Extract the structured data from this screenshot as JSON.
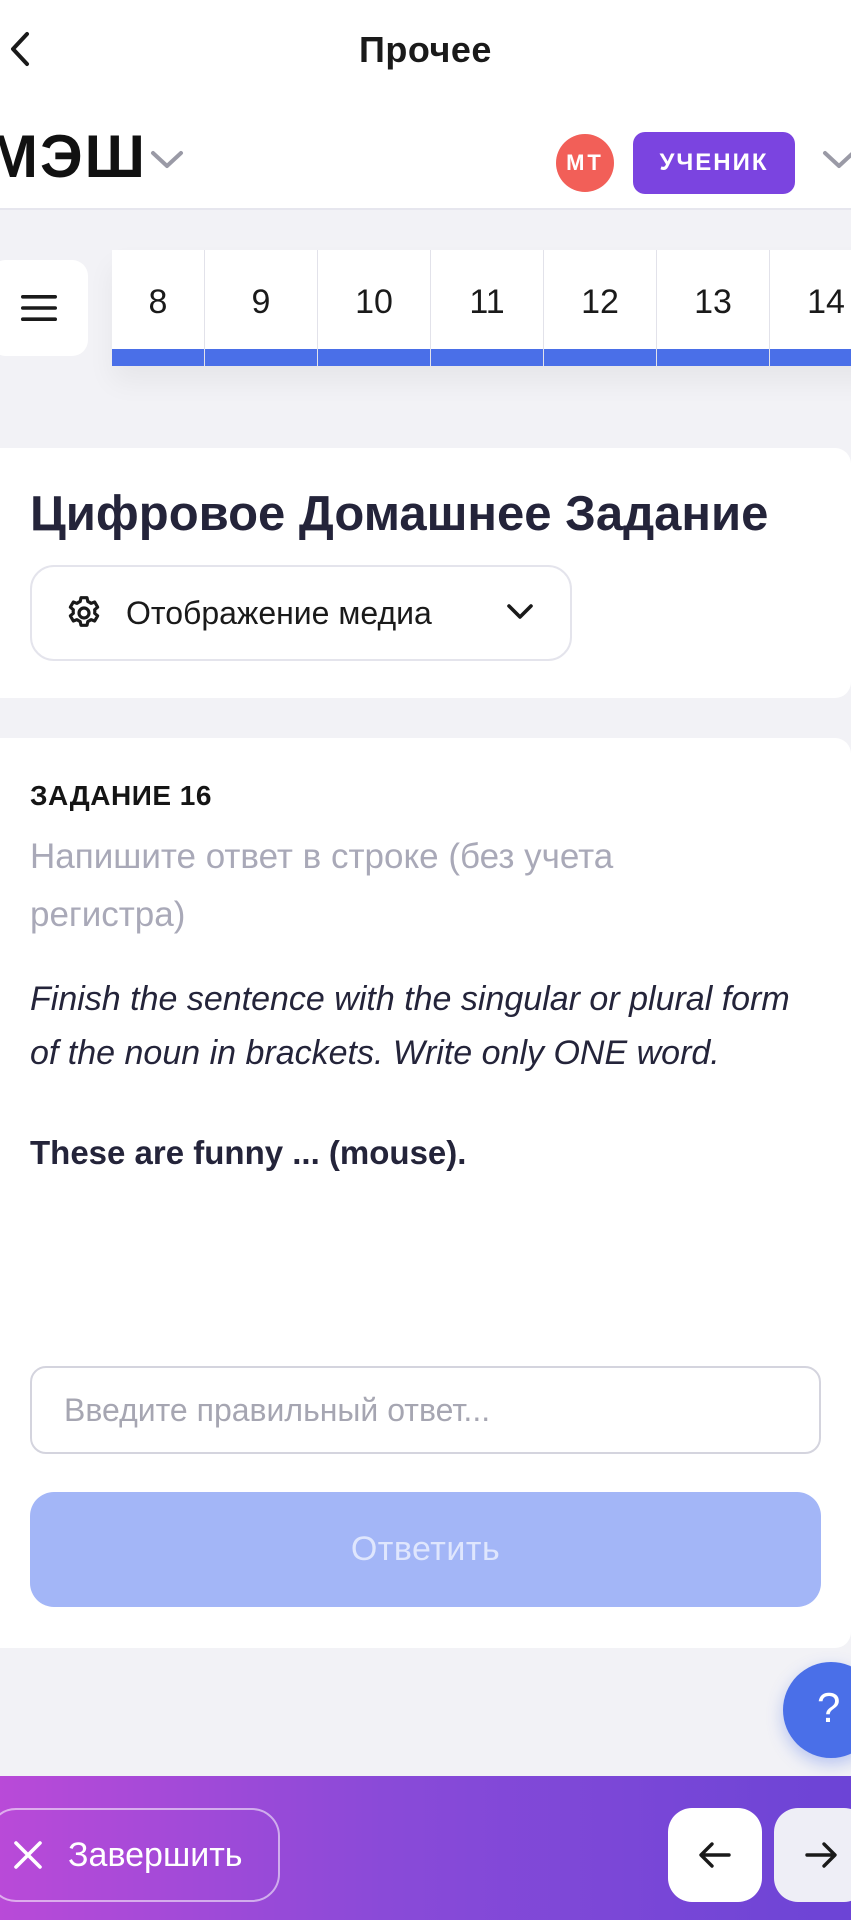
{
  "nav": {
    "title": "Прочее",
    "back_icon": "chevron-left-icon"
  },
  "brand": {
    "logo_text": "МЭШ",
    "user_initials": "МТ",
    "role": "УЧЕНИК",
    "colors": {
      "avatar": "#f25f58",
      "role_badge": "#7b44e0"
    }
  },
  "task_strip": {
    "menu_icon": "hamburger-menu-icon",
    "tasks": [
      "8",
      "9",
      "10",
      "11",
      "12",
      "13",
      "14"
    ],
    "accent_color": "#4a6fe8"
  },
  "header_card": {
    "title": "Цифровое Домашнее Задание",
    "media_button_label": "Отображение медиа"
  },
  "task": {
    "number_label": "ЗАДАНИЕ 16",
    "instruction": "Напишите ответ в строке (без учета регистра)",
    "text": "Finish the sentence with the singular or plural form of the noun in brackets. Write only ONE word.",
    "question": "These are funny ... (mouse).",
    "answer_placeholder": "Введите правильный ответ...",
    "answer_value": "",
    "submit_label": "Ответить"
  },
  "help": {
    "label": "?"
  },
  "footer": {
    "finish_label": "Завершить",
    "prev_icon": "arrow-left-icon",
    "next_icon": "arrow-right-icon"
  }
}
